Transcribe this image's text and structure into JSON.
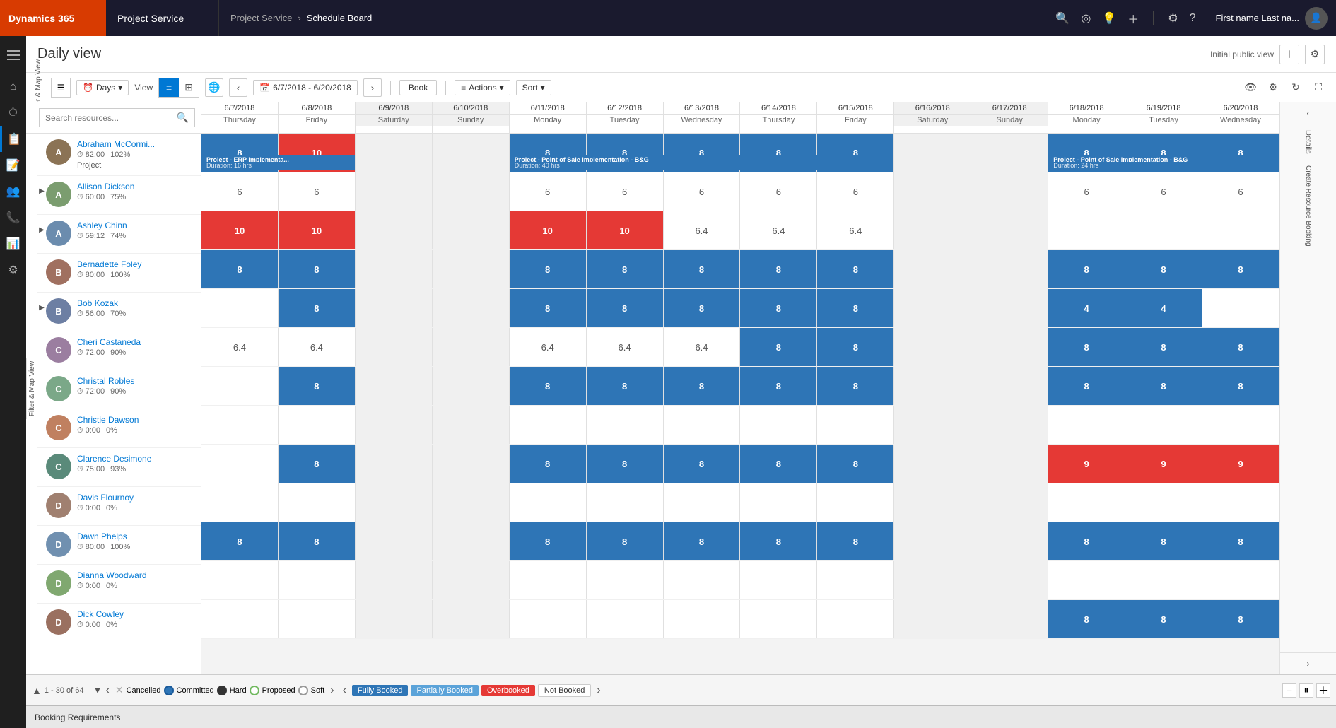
{
  "topnav": {
    "d365_label": "Dynamics 365",
    "app_label": "Project Service",
    "breadcrumb_parent": "Project Service",
    "breadcrumb_separator": "›",
    "breadcrumb_current": "Schedule Board",
    "user_name": "First name Last na...",
    "icons": [
      "search",
      "target",
      "lightbulb",
      "plus"
    ]
  },
  "page": {
    "title": "Daily view",
    "public_view_label": "Initial public view"
  },
  "toolbar": {
    "days_label": "Days",
    "view_label": "View",
    "date_range": "6/7/2018 - 6/20/2018",
    "book_label": "Book",
    "actions_label": "Actions",
    "sort_label": "Sort",
    "filter_map_label": "Filter & Map View"
  },
  "dates": [
    {
      "date": "6/7/2018",
      "day": "Thursday"
    },
    {
      "date": "6/8/2018",
      "day": "Friday"
    },
    {
      "date": "6/9/2018",
      "day": "Saturday"
    },
    {
      "date": "6/10/2018",
      "day": "Sunday"
    },
    {
      "date": "6/11/2018",
      "day": "Monday"
    },
    {
      "date": "6/12/2018",
      "day": "Tuesday"
    },
    {
      "date": "6/13/2018",
      "day": "Wednesday"
    },
    {
      "date": "6/14/2018",
      "day": "Thursday"
    },
    {
      "date": "6/15/2018",
      "day": "Friday"
    },
    {
      "date": "6/16/2018",
      "day": "Saturday"
    },
    {
      "date": "6/17/2018",
      "day": "Sunday"
    },
    {
      "date": "6/18/2018",
      "day": "Monday"
    },
    {
      "date": "6/19/2018",
      "day": "Tuesday"
    },
    {
      "date": "6/20/2018",
      "day": "Wednesday"
    }
  ],
  "resources": [
    {
      "name": "Abraham McCormi...",
      "hours": "82:00",
      "util": "102%",
      "project": "Project",
      "has_expand": false,
      "cells": [
        "8b",
        "10r",
        "",
        "",
        "8b",
        "8b",
        "8b",
        "8b",
        "8b",
        "",
        "",
        "8b",
        "8b",
        "8b"
      ],
      "bookings": [
        {
          "col_start": 0,
          "col_span": 2,
          "title": "Project - ERP Implementa...",
          "duration": "Duration: 16 hrs",
          "color": "blue"
        },
        {
          "col_start": 4,
          "col_span": 5,
          "title": "Project - Point of Sale Implementation - B&G",
          "duration": "Duration: 40 hrs",
          "color": "blue"
        },
        {
          "col_start": 11,
          "col_span": 3,
          "title": "Project - Point of Sale Implementation - B&G",
          "duration": "Duration: 24 hrs",
          "color": "blue"
        }
      ]
    },
    {
      "name": "Allison Dickson",
      "hours": "60:00",
      "util": "75%",
      "has_expand": true,
      "cells": [
        "6g",
        "6g",
        "",
        "",
        "6g",
        "6g",
        "6g",
        "6g",
        "6g",
        "",
        "",
        "6g",
        "6g",
        "6g"
      ]
    },
    {
      "name": "Ashley Chinn",
      "hours": "59:12",
      "util": "74%",
      "has_expand": true,
      "cells": [
        "10r",
        "10r",
        "",
        "",
        "10r",
        "10r",
        "6.4g",
        "6.4g",
        "6.4g",
        "",
        "",
        "",
        "",
        ""
      ]
    },
    {
      "name": "Bernadette Foley",
      "hours": "80:00",
      "util": "100%",
      "has_expand": false,
      "cells": [
        "8b",
        "8b",
        "",
        "",
        "8b",
        "8b",
        "8b",
        "8b",
        "8b",
        "",
        "",
        "8b",
        "8b",
        "8b"
      ]
    },
    {
      "name": "Bob Kozak",
      "hours": "56:00",
      "util": "70%",
      "has_expand": true,
      "cells": [
        "",
        "8b",
        "",
        "",
        "8b",
        "8b",
        "8b",
        "8b",
        "8b",
        "",
        "",
        "4g",
        "4g",
        ""
      ]
    },
    {
      "name": "Cheri Castaneda",
      "hours": "72:00",
      "util": "90%",
      "has_expand": false,
      "cells": [
        "6.4g",
        "6.4g",
        "",
        "",
        "6.4g",
        "6.4g",
        "6.4g",
        "8b",
        "8b",
        "",
        "",
        "8b",
        "8b",
        "8b"
      ]
    },
    {
      "name": "Christal Robles",
      "hours": "72:00",
      "util": "90%",
      "has_expand": false,
      "cells": [
        "",
        "8b",
        "",
        "",
        "8b",
        "8b",
        "8b",
        "8b",
        "8b",
        "",
        "",
        "8b",
        "8b",
        "8b"
      ]
    },
    {
      "name": "Christie Dawson",
      "hours": "0:00",
      "util": "0%",
      "has_expand": false,
      "cells": [
        "",
        "",
        "",
        "",
        "",
        "",
        "",
        "",
        "",
        "",
        "",
        "",
        "",
        ""
      ]
    },
    {
      "name": "Clarence Desimone",
      "hours": "75:00",
      "util": "93%",
      "has_expand": false,
      "cells": [
        "",
        "8b",
        "",
        "",
        "8b",
        "8b",
        "8b",
        "8b",
        "8b",
        "",
        "",
        "9r",
        "9r",
        "9r"
      ]
    },
    {
      "name": "Davis Flournoy",
      "hours": "0:00",
      "util": "0%",
      "has_expand": false,
      "cells": [
        "",
        "",
        "",
        "",
        "",
        "",
        "",
        "",
        "",
        "",
        "",
        "",
        "",
        ""
      ]
    },
    {
      "name": "Dawn Phelps",
      "hours": "80:00",
      "util": "100%",
      "has_expand": false,
      "cells": [
        "8b",
        "8b",
        "",
        "",
        "8b",
        "8b",
        "8b",
        "8b",
        "8b",
        "",
        "",
        "8b",
        "8b",
        "8b"
      ]
    },
    {
      "name": "Dianna Woodward",
      "hours": "0:00",
      "util": "0%",
      "has_expand": false,
      "cells": [
        "",
        "",
        "",
        "",
        "",
        "",
        "",
        "",
        "",
        "",
        "",
        "",
        "",
        ""
      ]
    },
    {
      "name": "Dick Cowley",
      "hours": "0:00",
      "util": "0%",
      "has_expand": false,
      "cells": [
        "",
        "",
        "",
        "",
        "",
        "",
        "",
        "",
        "",
        "",
        "",
        "8b",
        "8b",
        "8b"
      ]
    }
  ],
  "legend": {
    "cancelled": "Cancelled",
    "committed": "Committed",
    "hard": "Hard",
    "proposed": "Proposed",
    "soft": "Soft",
    "fully_booked": "Fully Booked",
    "partially_booked": "Partially Booked",
    "overbooked": "Overbooked",
    "not_booked": "Not Booked"
  },
  "pagination": {
    "range": "1 - 30 of 64"
  },
  "booking_req_label": "Booking Requirements",
  "right_panel": {
    "details": "Details",
    "create_booking": "Create Resource Booking"
  },
  "colors": {
    "blue": "#2e75b6",
    "red": "#e53935",
    "gray_cell": "#f0f0f0"
  }
}
